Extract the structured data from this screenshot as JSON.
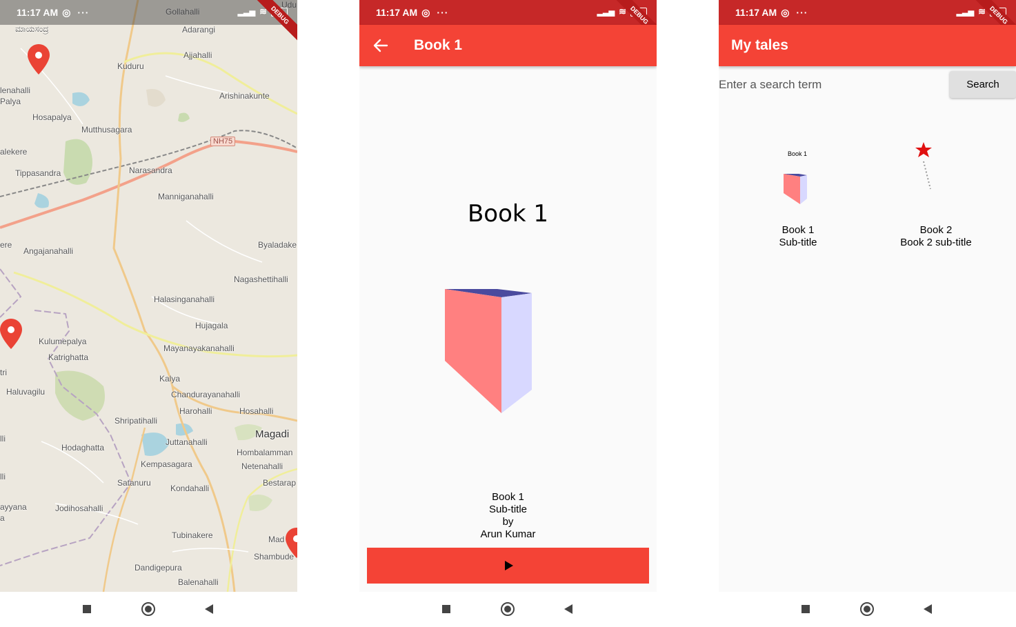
{
  "status": {
    "time": "11:17 AM",
    "dots": "···",
    "debug_banner": "DEBUG"
  },
  "map_screen": {
    "place_labels": [
      "Gollahalli",
      "Udu",
      "ಮಾಯಸಂದ್ರ",
      "Adarangi",
      "Ajjahalli",
      "Kuduru",
      "lenahalli",
      "Palya",
      "Arishinakunte",
      "Hosapalya",
      "Mutthusagara",
      "alekere",
      "Tippasandra",
      "Narasandra",
      "Manniganahalli",
      "ere",
      "Angajanahalli",
      "Byaladake",
      "Nagashettihalli",
      "Halasinganahalli",
      "Hujagala",
      "Kulumepalya",
      "Mayanayakanahalli",
      "Katrighatta",
      "Kalya",
      "tri",
      "Haluvagilu",
      "Chandurayanahalli",
      "Harohalli",
      "Hosahalli",
      "Shripatihalli",
      "Magadi",
      "lli",
      "Juttanahalli",
      "Hodaghatta",
      "Hombalamman",
      "Kempasagara",
      "Netenahalli",
      "Satanuru",
      "Bestarap",
      "lli",
      "Kondahalli",
      "ayyana",
      "a",
      "Jodihosahalli",
      "Tubinakere",
      "Mad",
      "Shambude",
      "Dandigepura",
      "Balenahalli"
    ],
    "highway_shield": "NH75"
  },
  "book_screen": {
    "title": "Book 1",
    "big_title": "Book 1",
    "meta_lines": [
      "Book 1",
      "Sub-title",
      "by",
      "Arun Kumar"
    ]
  },
  "list_screen": {
    "title": "My tales",
    "search_placeholder": "Enter a search term",
    "search_button": "Search",
    "books": [
      {
        "thumb_label": "Book 1",
        "title": "Book 1",
        "subtitle": "Sub-title"
      },
      {
        "thumb_label": "",
        "title": "Book 2",
        "subtitle": "Book 2 sub-title"
      }
    ]
  },
  "colors": {
    "primary": "#f44336",
    "primary_dark": "#c62828",
    "book_front": "#ff8080",
    "book_side": "#d8d8ff",
    "book_top": "#4a4a9e"
  },
  "icons": {
    "back": "arrow-left-icon",
    "play": "play-icon",
    "marker": "map-marker-icon",
    "nav_recents": "square-icon",
    "nav_home": "circle-icon",
    "nav_back": "triangle-back-icon"
  }
}
